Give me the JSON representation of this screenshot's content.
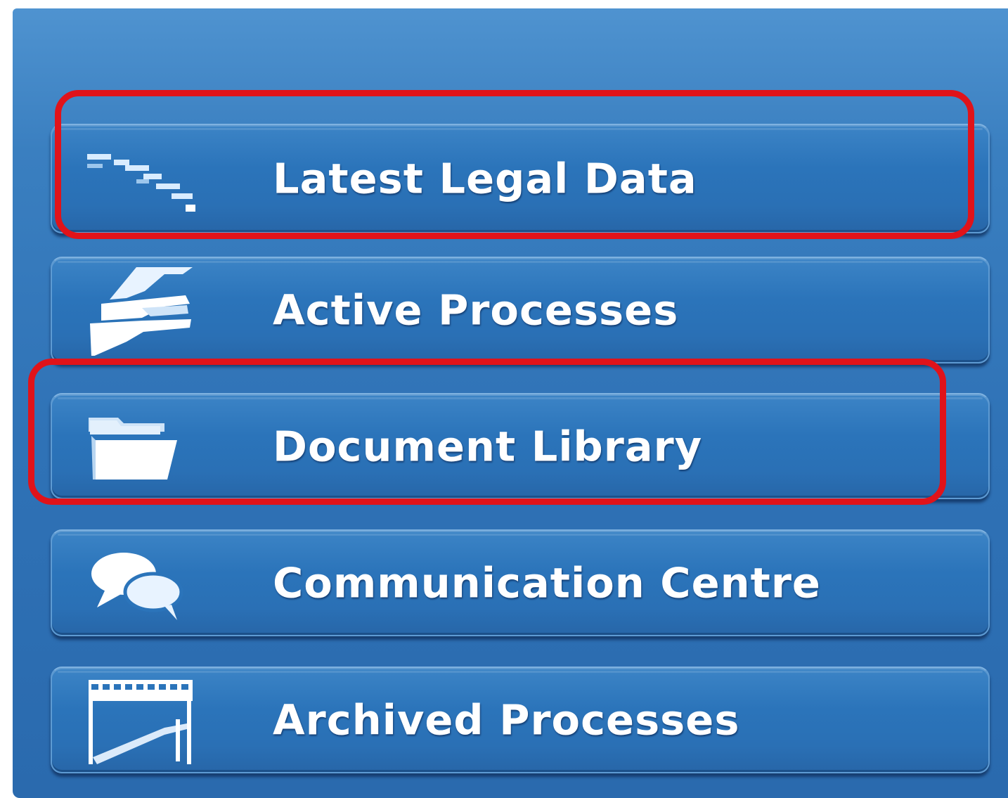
{
  "menu": {
    "items": [
      {
        "label": "Latest Legal Data",
        "icon": "legal-data-icon"
      },
      {
        "label": "Active Processes",
        "icon": "active-processes-icon"
      },
      {
        "label": "Document Library",
        "icon": "folder-icon"
      },
      {
        "label": "Communication Centre",
        "icon": "chat-bubbles-icon"
      },
      {
        "label": "Archived Processes",
        "icon": "archive-calendar-icon"
      }
    ]
  },
  "annotations": {
    "highlighted_items": [
      "Latest Legal Data",
      "Document Library"
    ],
    "color": "#e0131a"
  },
  "colors": {
    "panel": "#3a7fc0",
    "button": "#2b74ba",
    "label": "#ffffff"
  }
}
